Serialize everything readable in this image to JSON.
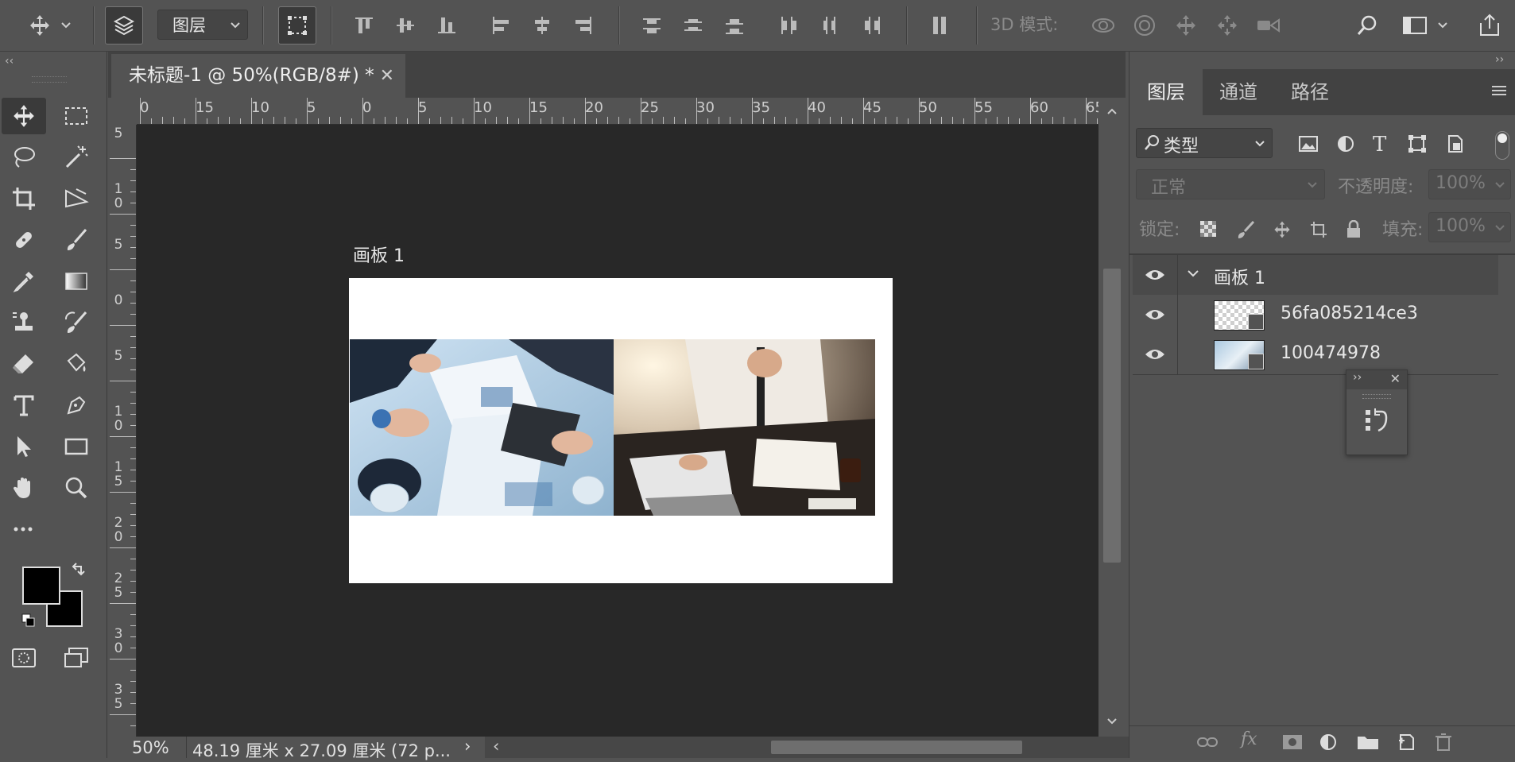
{
  "options_bar": {
    "auto_select_target": "图层",
    "mode_3d_label": "3D 模式:"
  },
  "document": {
    "tab_title": "未标题-1 @ 50%(RGB/8#) *",
    "artboard_label": "画板 1",
    "ruler_top_labels": [
      "0",
      "15",
      "10",
      "5",
      "0",
      "5",
      "10",
      "15",
      "20",
      "25",
      "30",
      "35",
      "40",
      "45",
      "50",
      "55",
      "60",
      "65"
    ],
    "ruler_left_labels": [
      "5",
      "1\n0",
      "5",
      "0",
      "5",
      "1\n0",
      "1\n5",
      "2\n0",
      "2\n5",
      "3\n0",
      "3\n5"
    ]
  },
  "status": {
    "zoom": "50%",
    "doc_size": "48.19 厘米 x 27.09 厘米 (72 p..."
  },
  "layers_panel": {
    "tabs": [
      "图层",
      "通道",
      "路径"
    ],
    "filter_kind": "类型",
    "blend_mode": "正常",
    "opacity_label": "不透明度:",
    "opacity_value": "100%",
    "lock_label": "锁定:",
    "fill_label": "填充:",
    "fill_value": "100%",
    "layers": [
      {
        "name": "画板 1",
        "type": "artboard"
      },
      {
        "name": "56fa085214ce3",
        "type": "smart-object"
      },
      {
        "name": "100474978",
        "type": "smart-object"
      }
    ]
  },
  "colors": {
    "ui_bg": "#535353",
    "canvas_bg": "#282828",
    "foreground": "#000000",
    "background": "#000000"
  }
}
